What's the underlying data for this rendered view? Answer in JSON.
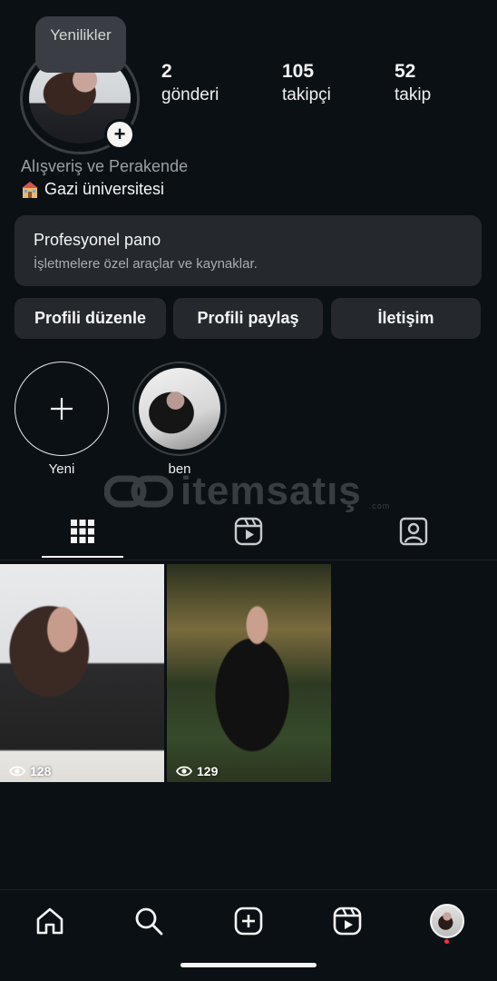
{
  "profile": {
    "tooltip": "Yenilikler",
    "category": "Alışveriş ve Perakende",
    "school": "Gazi üniversitesi",
    "school_icon": "school-emoji-icon"
  },
  "stats": [
    {
      "value": "2",
      "label": "gönderi"
    },
    {
      "value": "105",
      "label": "takipçi"
    },
    {
      "value": "52",
      "label": "takip"
    }
  ],
  "pro_dashboard": {
    "title": "Profesyonel pano",
    "subtitle": "İşletmelere özel araçlar ve kaynaklar."
  },
  "actions": {
    "edit": "Profili düzenle",
    "share": "Profili paylaş",
    "contact": "İletişim"
  },
  "highlights": [
    {
      "label": "Yeni"
    },
    {
      "label": "ben"
    }
  ],
  "watermark": {
    "text": "itemsatış",
    "suffix": ".com"
  },
  "tabs": [
    "grid-icon",
    "reels-icon",
    "tagged-icon"
  ],
  "posts": [
    {
      "views": "128"
    },
    {
      "views": "129"
    }
  ],
  "colors": {
    "background": "#0b1014",
    "card": "#25292e",
    "notification": "#ff3040"
  }
}
